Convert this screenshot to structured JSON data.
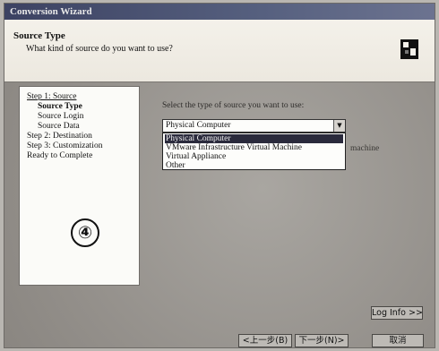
{
  "window": {
    "title": "Conversion Wizard"
  },
  "header": {
    "title": "Source Type",
    "subtitle": "What kind of source do you want to use?"
  },
  "steps": [
    {
      "label": "Step 1: Source",
      "state": "underlined"
    },
    {
      "label": "Source Type",
      "state": "current"
    },
    {
      "label": "Source Login",
      "state": "normal"
    },
    {
      "label": "Source Data",
      "state": "normal"
    },
    {
      "label": "Step 2: Destination",
      "state": "normal"
    },
    {
      "label": "Step 3: Customization",
      "state": "normal"
    },
    {
      "label": "Ready to Complete",
      "state": "normal"
    }
  ],
  "annotation": {
    "marker": "④"
  },
  "source": {
    "prompt": "Select the type of source you want to use:",
    "selected": "Physical Computer",
    "options": [
      "Physical Computer",
      "VMware Infrastructure Virtual Machine",
      "Virtual Appliance",
      "Other"
    ],
    "highlighted_index": 0,
    "partial_text": "machine"
  },
  "buttons": {
    "log_info": "Log Info >>",
    "back": "<上一步(B)",
    "next": "下一步(N)>",
    "cancel": "取消"
  },
  "colors": {
    "titlebar": "#3c4262",
    "header_bg": "#f4f1ea",
    "selection": "#2a2a3c"
  }
}
